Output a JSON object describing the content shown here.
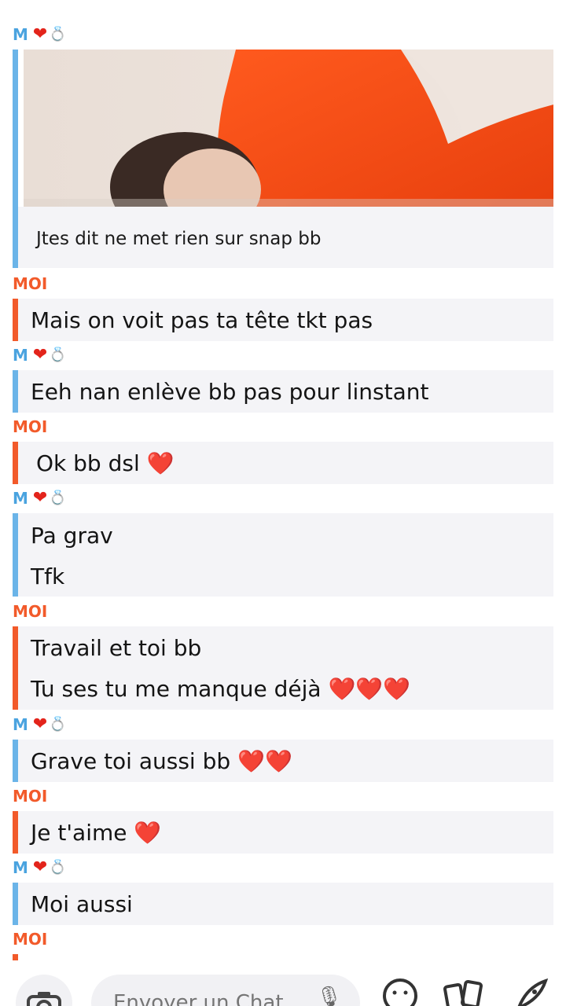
{
  "contact": {
    "initial": "M",
    "heart_icon": "red-heart-icon",
    "ring_icon": "ring-icon"
  },
  "me_label": "MOI",
  "photo_message": {
    "caption": "Jtes dit ne met rien sur snap bb"
  },
  "messages": [
    {
      "text": "Mais on voit pas ta tête tkt pas"
    },
    {
      "text": "Eeh nan enlève bb pas pour linstant"
    },
    {
      "text": "Ok bb dsl",
      "hearts": "❤️"
    },
    {
      "text": "Pa grav"
    },
    {
      "text": "Tfk"
    },
    {
      "text": "Travail et toi bb"
    },
    {
      "text": "Tu ses tu me manque déjà",
      "hearts": "❤️❤️❤️"
    },
    {
      "text": "Grave toi aussi bb",
      "hearts": "❤️❤️"
    },
    {
      "text": "Je t'aime",
      "hearts": "❤️"
    },
    {
      "text": "Moi aussi"
    }
  ],
  "input": {
    "placeholder": "Envoyer un Chat"
  },
  "colors": {
    "them": "#4aa3df",
    "me": "#f25a2a",
    "bubble": "#f4f4f7"
  },
  "icons": [
    "camera-icon",
    "mic-icon",
    "smiley-icon",
    "stickers-icon",
    "rocket-icon"
  ]
}
